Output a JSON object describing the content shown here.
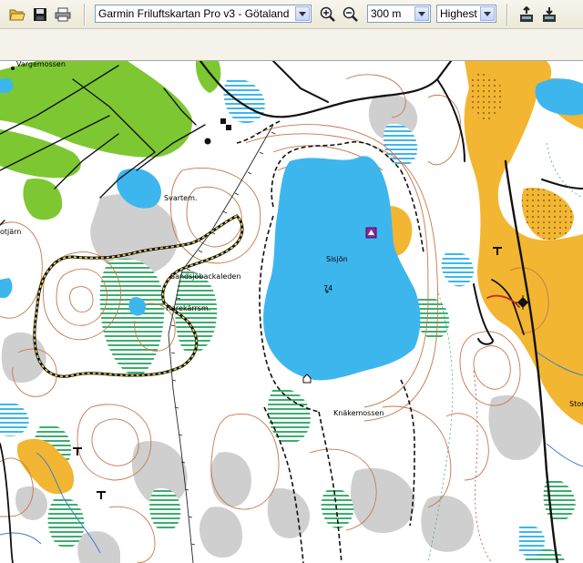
{
  "toolbar": {
    "open": {
      "icon": "folder-open-icon"
    },
    "save": {
      "icon": "save-disk-icon"
    },
    "print": {
      "icon": "printer-icon"
    },
    "map_product": {
      "value": "Garmin Friluftskartan Pro v3 - Götaland"
    },
    "zoom_in": {
      "icon": "zoom-in-icon"
    },
    "zoom_out": {
      "icon": "zoom-out-icon"
    },
    "zoom_scale": {
      "value": "300 m"
    },
    "detail_level": {
      "value": "Highest"
    },
    "send_to_device": {
      "icon": "send-to-device-icon"
    },
    "receive_from_device": {
      "icon": "receive-from-device-icon"
    }
  },
  "map": {
    "labels": {
      "top_left": "Vargemossen",
      "svartem": "Svartem.",
      "left_lake": "otjärn",
      "trail": "Sandsjöbackaleden",
      "harekarrsm": "Harekärrsm.",
      "lake": "Sisjön",
      "elevation": "74",
      "bog": "Knäkemossen",
      "right_edge": "Stor"
    },
    "colors": {
      "water": "#3db6ee",
      "forest_green": "#7dc832",
      "open_land": "#f2b632",
      "contours": "#c8764a",
      "rock": "#c8c8c8",
      "marsh": "#3cae6e",
      "roads": "#111111"
    }
  }
}
